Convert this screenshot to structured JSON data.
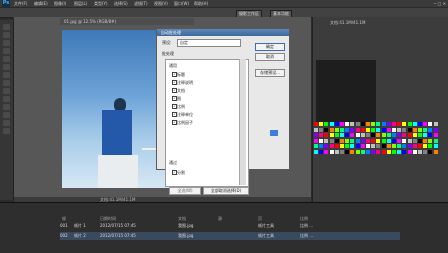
{
  "app": {
    "logo": "Ps"
  },
  "menu": [
    "文件(F)",
    "编辑(E)",
    "图像(I)",
    "图层(L)",
    "类型(Y)",
    "选择(S)",
    "滤镜(T)",
    "视图(V)",
    "窗口(W)",
    "帮助(H)"
  ],
  "window_controls": "─ □ ✕",
  "options_bar": {
    "workspace": "摄影工作区",
    "button": "基本功能"
  },
  "document": {
    "tab": "01.jpg @ 12.5% (RGB/8#)",
    "status": "文档:41.1M/41.1M"
  },
  "dialog": {
    "title": "自动批处理",
    "preset_label": "预设:",
    "preset_value": "自定",
    "section_label": "批处理",
    "list_header": "通用",
    "items": [
      {
        "label": "标题",
        "checked": true
      },
      {
        "label": "注释说明",
        "checked": true
      },
      {
        "label": "文档",
        "checked": true
      },
      {
        "label": "图",
        "checked": true
      },
      {
        "label": "比例",
        "checked": true
      },
      {
        "label": "注释单位",
        "checked": true
      },
      {
        "label": "比例因子",
        "checked": true
      }
    ],
    "list_footer": "通过",
    "list_footer_item": "分割",
    "buttons": {
      "ok": "确定",
      "cancel": "取消",
      "save": "存储预设..."
    },
    "bottom": {
      "left": "全选(W)",
      "right": "全部取消选择(D)"
    }
  },
  "right_panel": {
    "info_top": "文档:41.1M/41.1M",
    "coords": "X: 0\nY: 0"
  },
  "history": {
    "columns": [
      "帧",
      "日期时间",
      "文档",
      "源",
      "页",
      "比例"
    ],
    "rows": [
      {
        "id": "001",
        "name": "帧片 1",
        "date": "2012/07/15 07:45",
        "doc": "我图.jpg",
        "tool": "帧片工具",
        "scale": "比例 ..."
      },
      {
        "id": "002",
        "name": "帧片 2",
        "date": "2012/07/15 07:45",
        "doc": "我图.jpg",
        "tool": "帧片工具",
        "scale": "比例 ..."
      }
    ]
  },
  "swatch_colors": [
    "#ff0000",
    "#ffff00",
    "#00ff00",
    "#00ffff",
    "#0000ff",
    "#ff00ff",
    "#ffffff",
    "#c0c0c0",
    "#808080",
    "#000000",
    "#ff8000",
    "#80ff00",
    "#00ff80",
    "#0080ff",
    "#8000ff",
    "#ff0080"
  ]
}
